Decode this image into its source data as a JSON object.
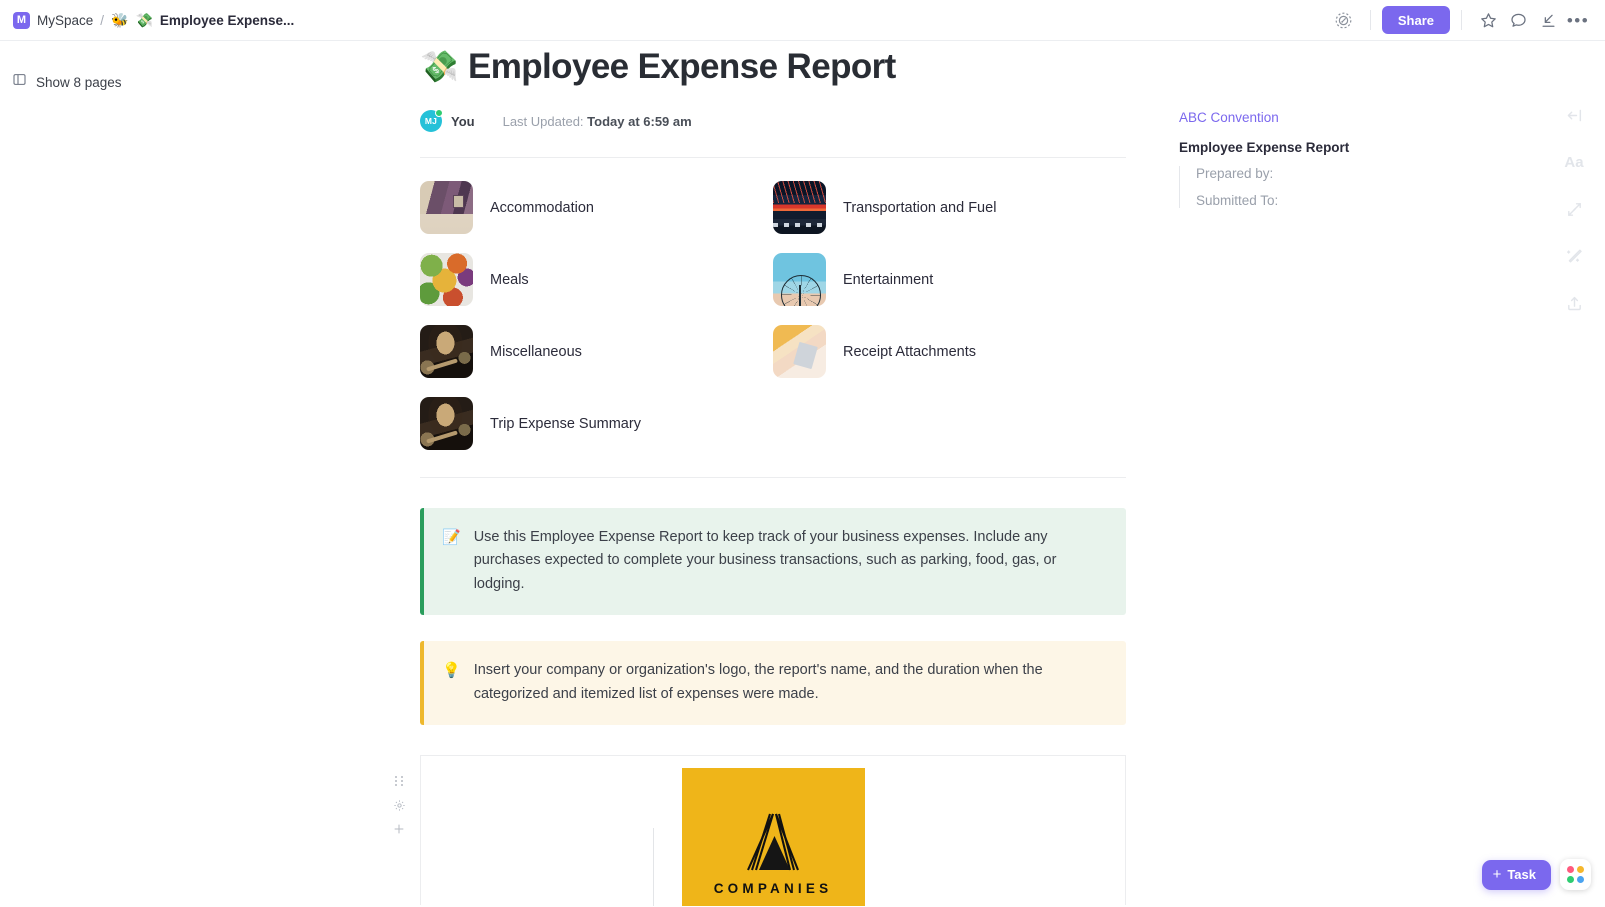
{
  "topbar": {
    "workspace_badge": "M",
    "workspace_name": "MySpace",
    "separator": "/",
    "space_emoji": "🐝",
    "doc_emoji": "💸",
    "doc_name": "Employee Expense...",
    "share_label": "Share",
    "icons": {
      "tracker": "tracker-icon",
      "star": "star-icon",
      "comment": "comment-icon",
      "collapse_down": "collapse-down-icon",
      "more": "more-options-icon"
    },
    "more_label": "•••",
    "accent": "#7b68ee"
  },
  "sidebar": {
    "show_pages_label": "Show 8 pages",
    "page_count": 8
  },
  "doc": {
    "title_emoji": "💸",
    "title": "Employee Expense Report",
    "author_initials": "MJ",
    "author_label": "You",
    "updated_prefix": "Last Updated:",
    "updated_value": "Today at 6:59 am"
  },
  "links": [
    {
      "label": "Accommodation",
      "thumb": "t-accom",
      "thumb_name": "hotel-room-thumbnail"
    },
    {
      "label": "Transportation and Fuel",
      "thumb": "t-trans",
      "thumb_name": "highway-traffic-thumbnail"
    },
    {
      "label": "Meals",
      "thumb": "t-meals",
      "thumb_name": "food-bowls-thumbnail"
    },
    {
      "label": "Entertainment",
      "thumb": "t-enter",
      "thumb_name": "ferris-wheel-thumbnail"
    },
    {
      "label": "Miscellaneous",
      "thumb": "t-misc",
      "thumb_name": "dessert-plate-thumbnail"
    },
    {
      "label": "Receipt Attachments",
      "thumb": "t-receipt",
      "thumb_name": "receipt-hand-thumbnail"
    },
    {
      "label": "Trip Expense Summary",
      "thumb": "t-trip",
      "thumb_name": "dessert-plate-thumbnail-2"
    }
  ],
  "callouts": {
    "green": {
      "emoji": "📝",
      "text": "Use this Employee Expense Report to keep track of your business expenses. Include any purchases expected to complete your business transactions, such as parking, food, gas, or lodging.",
      "bar_color": "#2a9d5c",
      "bg_color": "#e8f3ec"
    },
    "yellow": {
      "emoji": "💡",
      "text": "Insert your company or organization's logo, the report's name, and the duration when the categorized and itemized list of expenses were made.",
      "bar_color": "#eeb82d",
      "bg_color": "#fdf6e7"
    }
  },
  "logo_block": {
    "brand_word": "COMPANIES",
    "brand_color": "#efb519"
  },
  "outline": {
    "link": "ABC Convention",
    "heading": "Employee Expense Report",
    "children": [
      "Prepared by:",
      "Submitted To:"
    ],
    "link_color": "#7b68ee"
  },
  "rail": [
    {
      "name": "collapse-panel-icon",
      "glyph": "arrow-left-bar"
    },
    {
      "name": "text-format-icon",
      "glyph": "Aa"
    },
    {
      "name": "expand-relationships-icon",
      "glyph": "two-arrows"
    },
    {
      "name": "ai-magic-wand-icon",
      "glyph": "wand"
    },
    {
      "name": "share-export-icon",
      "glyph": "upload"
    }
  ],
  "fab": {
    "task_label": "Task",
    "task_plus": "+",
    "apps_icon": "app-grid-icon",
    "apps_colors": [
      "#ff5a7e",
      "#f5b72c",
      "#2ecc71",
      "#4aa3f0"
    ]
  }
}
